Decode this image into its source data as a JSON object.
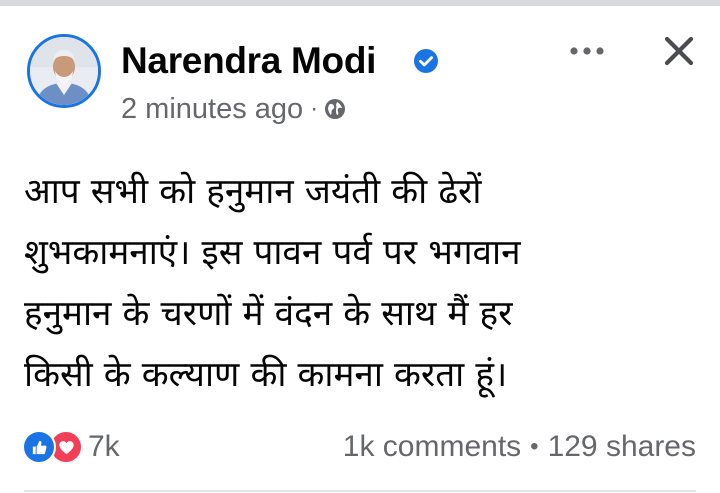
{
  "post": {
    "author": "Narendra Modi",
    "verified": true,
    "time": "2 minutes ago",
    "separator": "·",
    "audience_icon": "globe-icon",
    "message_lines": [
      "आप सभी को हनुमान जयंती की ढेरों",
      "शुभकामनाएं। इस पावन पर्व पर भगवान",
      "हनुमान के चरणों में वंदन के साथ मैं हर",
      "किसी के कल्याण की कामना करता हूं।"
    ],
    "reactions": {
      "icons": [
        "like-icon",
        "love-icon"
      ],
      "count": "7k"
    },
    "comments": "1k comments",
    "stats_separator": "•",
    "shares": "129 shares"
  },
  "colors": {
    "brand_blue": "#1b74e4",
    "love_red": "#f33e58",
    "secondary_text": "#65676b",
    "primary_text": "#050505"
  }
}
